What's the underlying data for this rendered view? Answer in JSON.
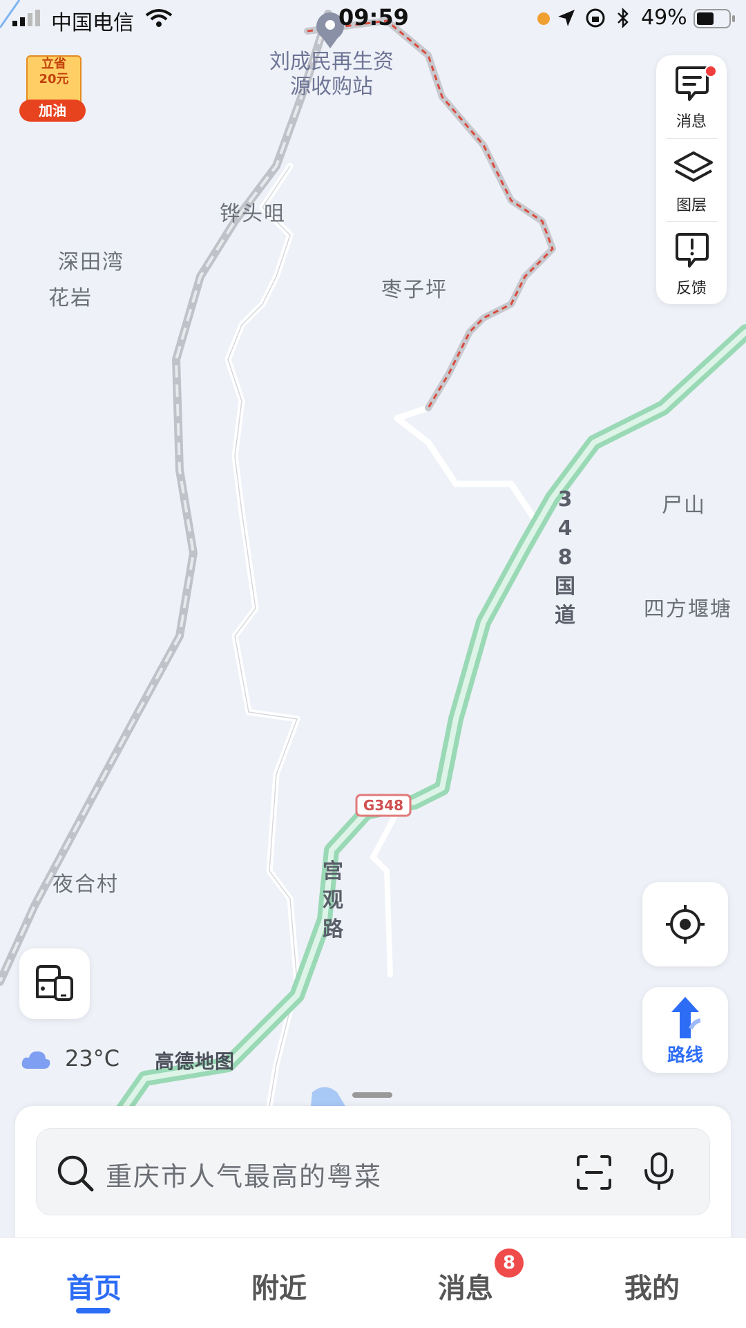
{
  "status_bar": {
    "carrier": "中国电信",
    "time": "09:59",
    "battery": "49%"
  },
  "promo": {
    "line1": "立省",
    "line2": "20元",
    "tag": "加油"
  },
  "side_panel": {
    "messages_label": "消息",
    "layers_label": "图层",
    "feedback_label": "反馈"
  },
  "map": {
    "poi": "刘成民再生资源收购站",
    "labels": {
      "chantouzu": "铧头咀",
      "shentianwan": "深田湾",
      "huayan": "花岩",
      "zaoziping": "枣子坪",
      "shishan": "尸山",
      "sifangyantang": "四方堰塘",
      "yehecun": "夜合村"
    },
    "road_348_chars": [
      "3",
      "4",
      "8",
      "国",
      "道"
    ],
    "gongguanlu_chars": [
      "宫",
      "观",
      "路"
    ],
    "route_shield": "G348"
  },
  "weather": {
    "temperature": "23°C"
  },
  "watermark": "高德地图",
  "search": {
    "placeholder": "重庆市人气最高的粤菜"
  },
  "route_button": {
    "label": "路线"
  },
  "tabs": {
    "home": "首页",
    "nearby": "附近",
    "messages": "消息",
    "messages_badge": "8",
    "mine": "我的"
  }
}
